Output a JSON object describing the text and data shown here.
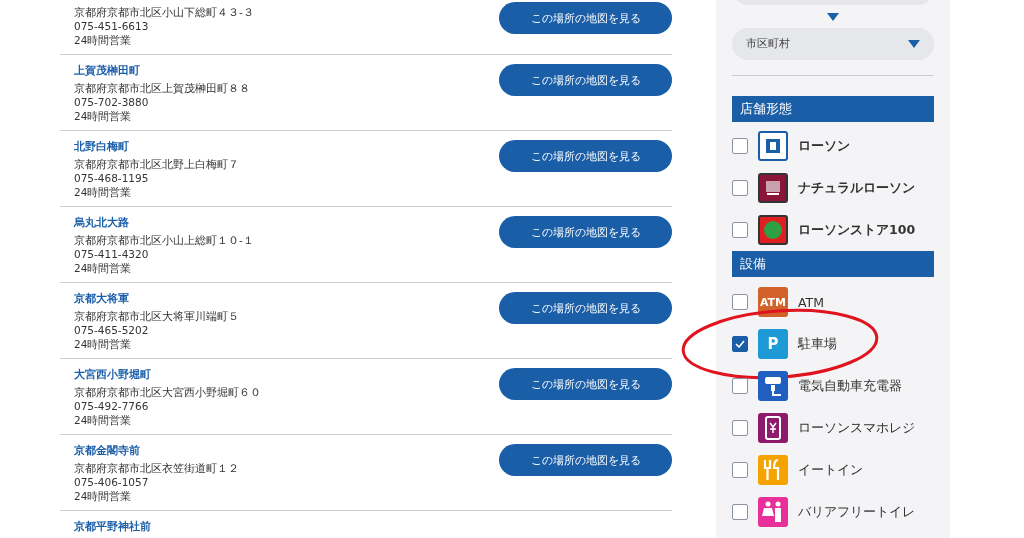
{
  "stores": [
    {
      "address": "京都府京都市北区小山下総町４３-３",
      "phone": "075-451-6613",
      "hours": "24時間営業",
      "map_button": "この場所の地図を見る"
    },
    {
      "name": "上賀茂榊田町",
      "address": "京都府京都市北区上賀茂榊田町８８",
      "phone": "075-702-3880",
      "hours": "24時間営業",
      "map_button": "この場所の地図を見る"
    },
    {
      "name": "北野白梅町",
      "address": "京都府京都市北区北野上白梅町７",
      "phone": "075-468-1195",
      "hours": "24時間営業",
      "map_button": "この場所の地図を見る"
    },
    {
      "name": "烏丸北大路",
      "address": "京都府京都市北区小山上総町１０-１",
      "phone": "075-411-4320",
      "hours": "24時間営業",
      "map_button": "この場所の地図を見る"
    },
    {
      "name": "京都大将軍",
      "address": "京都府京都市北区大将軍川端町５",
      "phone": "075-465-5202",
      "hours": "24時間営業",
      "map_button": "この場所の地図を見る"
    },
    {
      "name": "大宮西小野堀町",
      "address": "京都府京都市北区大宮西小野堀町６０",
      "phone": "075-492-7766",
      "hours": "24時間営業",
      "map_button": "この場所の地図を見る"
    },
    {
      "name": "京都金閣寺前",
      "address": "京都府京都市北区衣笠街道町１２",
      "phone": "075-406-1057",
      "hours": "24時間営業",
      "map_button": "この場所の地図を見る"
    },
    {
      "name": "京都平野神社前"
    }
  ],
  "sidebar": {
    "city_select": {
      "placeholder": "市区町村"
    },
    "sections": [
      {
        "title": "店舗形態",
        "items": [
          {
            "label": "ローソン",
            "checked": false,
            "kind": "lawson",
            "color": "#ffffff"
          },
          {
            "label": "ナチュラルローソン",
            "checked": false,
            "kind": "natural",
            "color": "#8a1538"
          },
          {
            "label": "ローソンストア100",
            "checked": false,
            "kind": "store100",
            "color": "#e02020"
          }
        ]
      },
      {
        "title": "設備",
        "items": [
          {
            "label": "ATM",
            "checked": false,
            "kind": "atm",
            "color": "#d2622a",
            "icon_text": "ATM"
          },
          {
            "label": "駐車場",
            "checked": true,
            "kind": "parking",
            "color": "#1e9ad6",
            "icon_text": "P",
            "highlighted": true
          },
          {
            "label": "電気自動車充電器",
            "checked": false,
            "kind": "ev",
            "color": "#1f5fbf"
          },
          {
            "label": "ローソンスマホレジ",
            "checked": false,
            "kind": "phone",
            "color": "#8e1a6b"
          },
          {
            "label": "イートイン",
            "checked": false,
            "kind": "eatin",
            "color": "#f5a300"
          },
          {
            "label": "バリアフリートイレ",
            "checked": false,
            "kind": "toilet",
            "color": "#e8309a"
          }
        ]
      }
    ]
  }
}
